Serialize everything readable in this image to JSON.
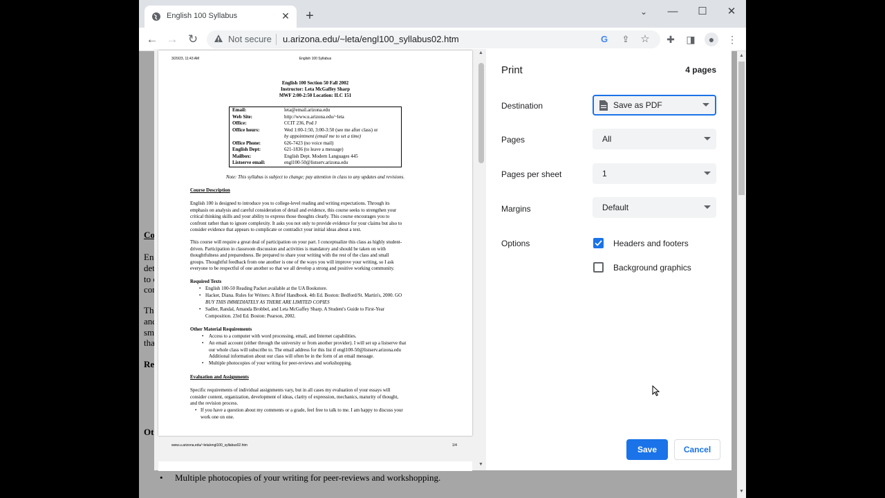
{
  "browser": {
    "tab_title": "English 100 Syllabus",
    "not_secure": "Not secure",
    "url": "u.arizona.edu/~leta/engl100_syllabus02.htm"
  },
  "background_page": {
    "fragments": [
      "Co",
      "En",
      "det",
      "to c",
      "con",
      "Th",
      "and",
      "sm",
      "tha",
      "Re",
      "Ot"
    ],
    "bullet_line": "Multiple photocopies of your writing for peer-reviews and workshopping."
  },
  "preview": {
    "header_left": "3/20/23, 11:43 AM",
    "header_center": "English 100 Syllabus",
    "title1": "English 100 Section 50 Fall 2002",
    "title2": "Instructor: Leta McGaffey Sharp",
    "title3": "MWF 2:00-2:50 Location: ILC 151",
    "contact": [
      {
        "label": "Email:",
        "value": "leta@email.arizona.edu"
      },
      {
        "label": "Web Site:",
        "value": "http://www.u.arizona.edu/~leta"
      },
      {
        "label": "Office:",
        "value": "CCIT 236, Pod J"
      },
      {
        "label": "Office hours:",
        "value": "Wed 1:00-1:50, 3:00-3:50 (see me after class) or"
      },
      {
        "label": "",
        "value": "by appointment (email me to set a time)"
      },
      {
        "label": "Office Phone:",
        "value": "626-7423 (no voice mail)"
      },
      {
        "label": "English Dept:",
        "value": "621-1836 (to leave a message)"
      },
      {
        "label": "Mailbox:",
        "value": "English Dept. Modern Languages 445"
      },
      {
        "label": "Listserve email:",
        "value": "engl100-50@listserv.arizona.edu"
      }
    ],
    "note": "Note: This syllabus is subject to change; pay attention in class to any updates and revisions.",
    "course_desc_heading": "Course Description",
    "course_desc_p1": [
      "English 100 is designed to introduce you to college-level reading and writing expectations. Through its",
      "emphasis on analysis and careful consideration of detail and evidence, this course seeks to strengthen your",
      "critical thinking skills and your ability to express those thoughts clearly. This course encourages you to",
      "confront rather than to ignore complexity. It asks you not only to provide evidence for your claims but also to",
      "consider evidence that appears to complicate or contradict your initial ideas about a text."
    ],
    "course_desc_p2": [
      "This course will require a great deal of participation on your part. I conceptualize this class as highly student-",
      "driven. Participation in classroom discussion and activities is mandatory and should be taken on with",
      "thoughtfulness and preparedness. Be prepared to share your writing with the rest of the class and small",
      "groups. Thoughtful feedback from one another is one of the ways you will improve your writing, so I ask",
      "everyone to be respectful of one another so that we all develop a strong and positive working community."
    ],
    "required_heading": "Required Texts",
    "required_items": [
      "English 100-50 Reading Packet available at the UA Bookstore.",
      "Hacker, Diana. Rules for Writers: A Brief Handbook. 4th Ed. Boston: Bedford/St. Martin's, 2000. GO",
      "BUY THIS IMMEDIATELY AS THERE ARE LIMITED COPIES",
      "Sadler, Randal, Amanda Brobbel, and Leta McGaffey Sharp. A Student's Guide to First-Year",
      "Composition. 23rd Ed. Boston: Pearson, 2002."
    ],
    "other_heading": "Other Material Requirements",
    "other_items": [
      "Access to a computer with word processing, email, and Internet capabilities.",
      "An email account (either through the university or from another provider). I will set up a listserve that",
      "our whole class will subscribe to. The email address for this list if engl100-50@listserv.arizona.edu",
      "Additional information about our class will often be in the form of an email message.",
      "Multiple photocopies of your writing for peer-reviews and workshopping."
    ],
    "eval_heading": "Evaluation and Assignments",
    "eval_p": [
      "Specific requirements of individual assignments vary, but in all cases my evaluation of your essays will",
      "consider content, organization, development of ideas, clarity of expression, mechanics, maturity of thought,",
      "and the revision process."
    ],
    "eval_items": [
      "If you have a question about my comments or a grade, feel free to talk to me. I am happy to discuss your",
      "work one on one."
    ],
    "footer_left": "www.u.arizona.edu/~leta/engl100_syllabus02.htm",
    "footer_right": "1/4"
  },
  "print_dialog": {
    "title": "Print",
    "page_count": "4 pages",
    "destination_label": "Destination",
    "destination_value": "Save as PDF",
    "pages_label": "Pages",
    "pages_value": "All",
    "pps_label": "Pages per sheet",
    "pps_value": "1",
    "margins_label": "Margins",
    "margins_value": "Default",
    "options_label": "Options",
    "opt_headers": "Headers and footers",
    "opt_headers_checked": true,
    "opt_bg": "Background graphics",
    "opt_bg_checked": false,
    "save_label": "Save",
    "cancel_label": "Cancel",
    "accent": "#1a73e8"
  }
}
